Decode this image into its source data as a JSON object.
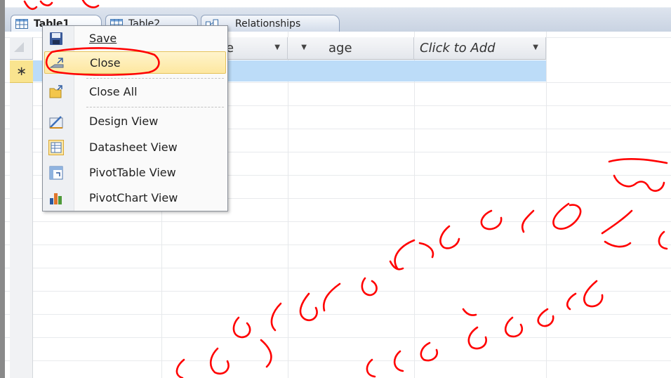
{
  "tabs": [
    {
      "label": "Table1",
      "active": true
    },
    {
      "label": "Table2",
      "active": false
    },
    {
      "label": "Relationships",
      "active": false
    }
  ],
  "columns": [
    {
      "label": "e",
      "has_dropdown": true
    },
    {
      "label": "age",
      "has_dropdown": true
    },
    {
      "label": "Click to Add",
      "has_dropdown": true
    }
  ],
  "new_record_marker": "∗",
  "context_menu": {
    "items": [
      {
        "label": "Save",
        "icon": "save-icon"
      },
      {
        "label": "Close",
        "icon": "close-table-icon",
        "highlighted": true
      },
      {
        "label": "Close All",
        "icon": "close-all-icon"
      },
      {
        "label": "Design View",
        "icon": "design-view-icon"
      },
      {
        "label": "Datasheet View",
        "icon": "datasheet-view-icon"
      },
      {
        "label": "PivotTable View",
        "icon": "pivottable-view-icon"
      },
      {
        "label": "PivotChart View",
        "icon": "pivotchart-view-icon"
      }
    ]
  },
  "colors": {
    "annotation_ink": "#ff0000",
    "row_selected": "#bcdcf8",
    "new_record": "#f9e48f",
    "menu_highlight": "#fde7a0"
  }
}
